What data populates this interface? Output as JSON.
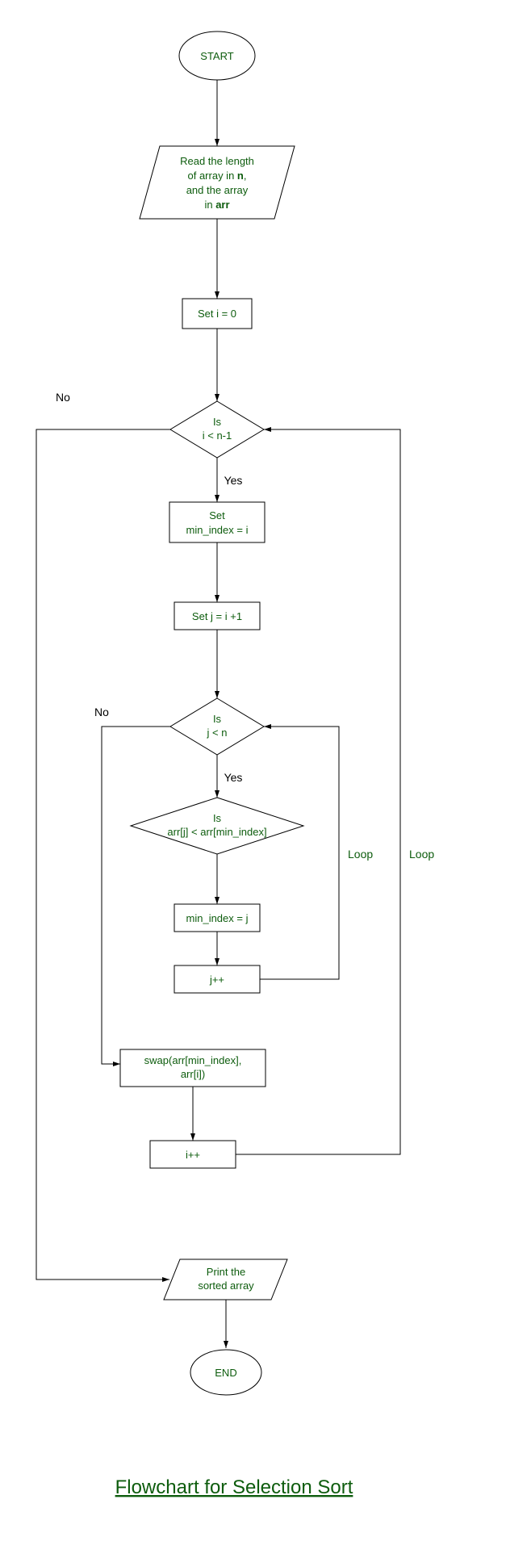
{
  "nodes": {
    "start": "START",
    "read1": "Read the length",
    "read2": "of array in ",
    "read2b": "n",
    "read2c": ",",
    "read3": "and the array",
    "read4": "in ",
    "read4b": "arr",
    "setI": "Set i = 0",
    "decI1": "Is",
    "decI2": "i < n-1",
    "setMin": "Set",
    "setMin2": "min_index = i",
    "setJ": "Set j = i +1",
    "decJ1": "Is",
    "decJ2": "j < n",
    "decCmp1": "Is",
    "decCmp2": "arr[j] < arr[min_index]",
    "minJ": "min_index = j",
    "jpp": "j++",
    "swap1": "swap(arr[min_index],",
    "swap2": "arr[i])",
    "ipp": "i++",
    "print1": "Print the",
    "print2": "sorted array",
    "end": "END"
  },
  "labels": {
    "yes": "Yes",
    "no": "No",
    "loop": "Loop"
  },
  "title": "Flowchart for Selection Sort"
}
